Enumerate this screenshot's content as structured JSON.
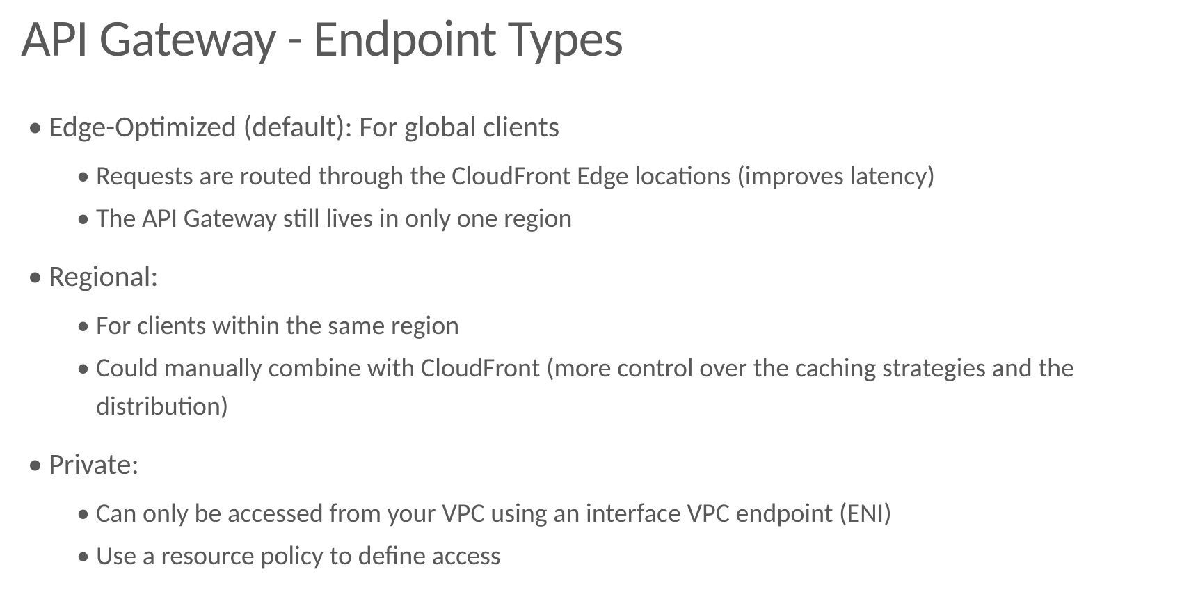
{
  "title": "API Gateway - Endpoint Types",
  "sections": [
    {
      "lead": "Edge-Optimized (default): ",
      "rest": " For global clients",
      "subs": [
        "Requests are routed through the CloudFront Edge locations (improves latency)",
        "The API Gateway still lives in only one region"
      ]
    },
    {
      "lead": "Regional:",
      "rest": "",
      "subs": [
        "For clients within the same region",
        "Could manually combine with CloudFront (more control over the caching strategies and the distribution)"
      ]
    },
    {
      "lead": "Private:",
      "rest": "",
      "subs": [
        "Can only be accessed from your VPC using an interface VPC endpoint (ENI)",
        "Use a resource policy to define access"
      ]
    }
  ]
}
